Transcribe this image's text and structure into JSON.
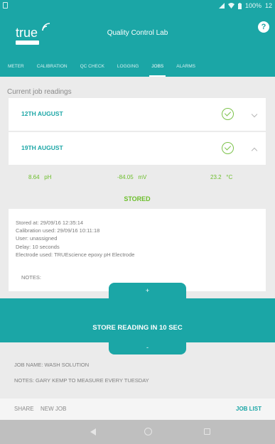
{
  "status_bar": {
    "battery": "100%",
    "time": "12"
  },
  "app_bar": {
    "logo_text": "true",
    "title": "Quality Control Lab",
    "help_icon": "?"
  },
  "tabs": [
    {
      "label": "METER"
    },
    {
      "label": "CALIBRATION"
    },
    {
      "label": "QC CHECK"
    },
    {
      "label": "LOGGING"
    },
    {
      "label": "JOBS",
      "active": true
    },
    {
      "label": "ALARMS"
    }
  ],
  "section_title": "Current job readings",
  "jobs": [
    {
      "date": "12TH AUGUST",
      "expanded": false
    },
    {
      "date": "19TH AUGUST",
      "expanded": true
    }
  ],
  "reading": {
    "ph_value": "8.64",
    "ph_unit": "pH",
    "mv_value": "-84.05",
    "mv_unit": "mV",
    "temp_value": "23.2",
    "temp_unit": "°C",
    "status": "STORED"
  },
  "details": {
    "stored_at": "Stored at: 29/09/16 12:35:14",
    "calibration": "Calibration used: 29/09/16 10:11:18",
    "user": "User: unassigned",
    "delay": "Delay: 10 seconds",
    "electrode": "Electrode used: TRUEscience epoxy pH Electrode",
    "notes_label": "NOTES:"
  },
  "store": {
    "plus": "+",
    "minus": "-",
    "label": "STORE READING IN 10 SEC"
  },
  "job_info": {
    "job_name": "JOB NAME: WASH SOLUTION",
    "notes": "NOTES: GARY KEMP TO MEASURE EVERY TUESDAY"
  },
  "bottom_actions": {
    "share": "SHARE",
    "new_job": "NEW JOB",
    "job_list": "JOB LIST"
  },
  "colors": {
    "accent": "#1ba6a6",
    "ok_green": "#6cbe2b",
    "check_green": "#7cc24a"
  },
  "icons": [
    "check-circle-icon",
    "chevron-down-icon",
    "chevron-up-icon",
    "help-icon",
    "back-icon",
    "home-icon",
    "recents-icon"
  ]
}
